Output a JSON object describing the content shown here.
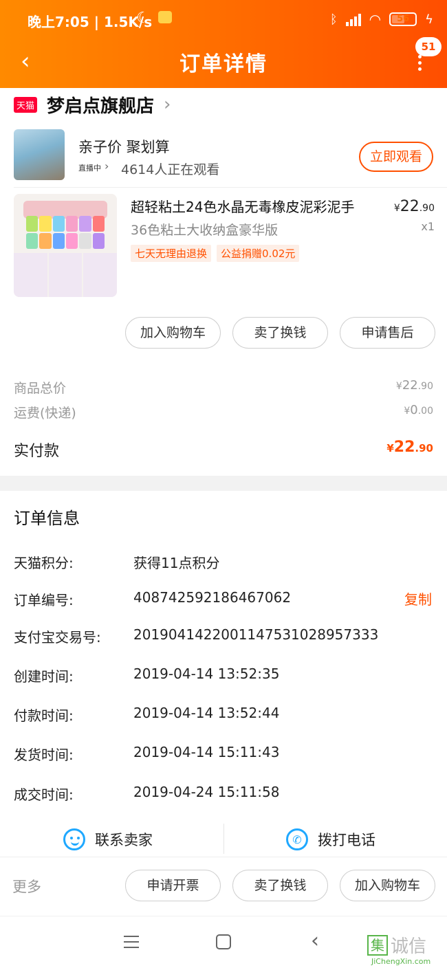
{
  "status": {
    "time": "晚上7:05 | 1.5K/s",
    "battery": "56",
    "battery_level": 0.56
  },
  "header": {
    "title": "订单详情",
    "badge": "51"
  },
  "shop": {
    "logo_text": "天猫",
    "name": "梦启点旗舰店"
  },
  "live": {
    "title": "亲子价 聚划算",
    "tag": "直播中",
    "viewers": "4614人正在观看",
    "watch_button": "立即观看"
  },
  "product": {
    "name": "超轻粘土24色水晶无毒橡皮泥彩泥手",
    "spec": "36色粘土大收纳盒豪华版",
    "tags": [
      "七天无理由退换",
      "公益捐赠0.02元"
    ],
    "price_yen": "¥",
    "price_int": "22",
    "price_dec": ".90",
    "qty": "x1"
  },
  "actions": {
    "add_cart": "加入购物车",
    "resell": "卖了换钱",
    "after_sale": "申请售后"
  },
  "summary": {
    "goods_label": "商品总价",
    "goods_int": "22",
    "goods_dec": ".90",
    "ship_label": "运费(快递)",
    "ship_int": "0",
    "ship_dec": ".00",
    "paid_label": "实付款",
    "paid_int": "22",
    "paid_dec": ".90",
    "yen": "¥"
  },
  "order_info": {
    "title": "订单信息",
    "rows": [
      {
        "label": "天猫积分:",
        "value": "获得11点积分"
      },
      {
        "label": "订单编号:",
        "value": "408742592186467062"
      },
      {
        "label": "支付宝交易号:",
        "value": "2019041422001147531028957333"
      },
      {
        "label": "创建时间:",
        "value": "2019-04-14 13:52:35"
      },
      {
        "label": "付款时间:",
        "value": "2019-04-14 13:52:44"
      },
      {
        "label": "发货时间:",
        "value": "2019-04-14 15:11:43"
      },
      {
        "label": "成交时间:",
        "value": "2019-04-24 15:11:58"
      }
    ],
    "copy": "复制"
  },
  "contact": {
    "seller": "联系卖家",
    "call": "拨打电话"
  },
  "footer": {
    "more": "更多",
    "invoice": "申请开票",
    "resell": "卖了换钱",
    "add_cart": "加入购物车"
  },
  "watermark": {
    "brand": "诚信",
    "url": "JiChengXin.com",
    "box_char": "集"
  },
  "colors": {
    "accent": "#ff5000",
    "header_start": "#ff8a00",
    "header_end": "#ff4e00",
    "link_blue": "#1fa8ff"
  }
}
